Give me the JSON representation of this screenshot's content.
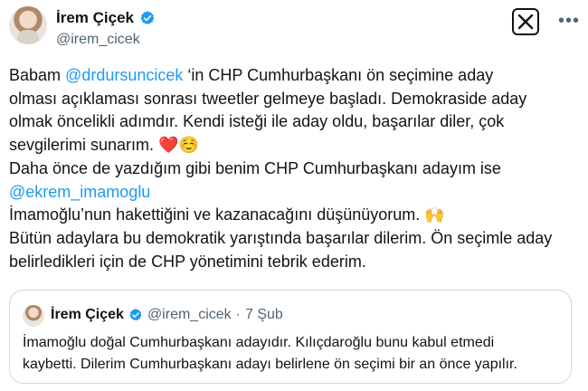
{
  "author": {
    "name": "İrem Çiçek",
    "handle": "@irem_cicek"
  },
  "tweet": {
    "line1_pre": "Babam ",
    "line1_mention": "@drdursuncicek",
    "line1_post": " ‘in CHP Cumhurbaşkanı ön seçimine aday",
    "line2": "olması açıklaması sonrası tweetler gelmeye başladı.  Demokraside aday",
    "line3": "olmak öncelikli adımdır. Kendi isteği ile aday oldu, başarılar diler, çok",
    "line4": "sevgilerimi sunarım.",
    "line4_emoji1": "❤️",
    "line4_emoji2": "☺️",
    "line5": "Daha önce de yazdığım gibi benim CHP Cumhurbaşkanı adayım ise",
    "line6_mention": "@ekrem_imamoglu",
    "line7": "İmamoğlu’nun hakettiğini ve kazanacağını düşünüyorum.",
    "line7_emoji": "🙌",
    "line8": "Bütün adaylara bu demokratik yarıştında başarılar dilerim. Ön seçimle aday",
    "line9": "belirledikleri için de CHP yönetimini tebrik ederim."
  },
  "quote": {
    "name": "İrem Çiçek",
    "handle": "@irem_cicek",
    "separator": "·",
    "date": "7 Şub",
    "line1": "İmamoğlu doğal Cumhurbaşkanı adayıdır. Kılıçdaroğlu bunu kabul etmedi",
    "line2": "kaybetti. Dilerim Cumhurbaşkanı adayı belirlene ön seçimi bir an önce yapılır."
  },
  "icons": {
    "verified": "verified-badge-icon",
    "x_logo": "x-logo-icon",
    "more": "more-options-icon"
  },
  "colors": {
    "mention": "#1d9bf0",
    "verified": "#1d9bf0",
    "secondary_text": "#536471"
  }
}
